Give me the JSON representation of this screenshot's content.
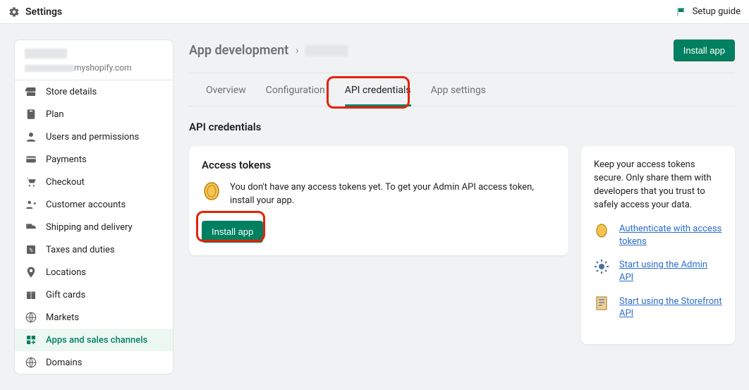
{
  "topbar": {
    "title": "Settings",
    "setup_guide": "Setup guide"
  },
  "store": {
    "domain_suffix": "myshopify.com"
  },
  "sidebar": {
    "items": [
      {
        "label": "Store details"
      },
      {
        "label": "Plan"
      },
      {
        "label": "Users and permissions"
      },
      {
        "label": "Payments"
      },
      {
        "label": "Checkout"
      },
      {
        "label": "Customer accounts"
      },
      {
        "label": "Shipping and delivery"
      },
      {
        "label": "Taxes and duties"
      },
      {
        "label": "Locations"
      },
      {
        "label": "Gift cards"
      },
      {
        "label": "Markets"
      },
      {
        "label": "Apps and sales channels"
      },
      {
        "label": "Domains"
      }
    ],
    "active_index": 11
  },
  "breadcrumb": {
    "root": "App development"
  },
  "header": {
    "install_button": "Install app"
  },
  "tabs": {
    "items": [
      "Overview",
      "Configuration",
      "API credentials",
      "App settings"
    ],
    "active_index": 2
  },
  "section": {
    "title": "API credentials"
  },
  "access_tokens": {
    "title": "Access tokens",
    "message": "You don't have any access tokens yet. To get your Admin API access token, install your app.",
    "install_button": "Install app"
  },
  "info_card": {
    "message": "Keep your access tokens secure. Only share them with developers that you trust to safely access your data.",
    "links": [
      {
        "label": "Authenticate with access tokens"
      },
      {
        "label": "Start using the Admin API"
      },
      {
        "label": "Start using the Storefront API"
      }
    ]
  }
}
